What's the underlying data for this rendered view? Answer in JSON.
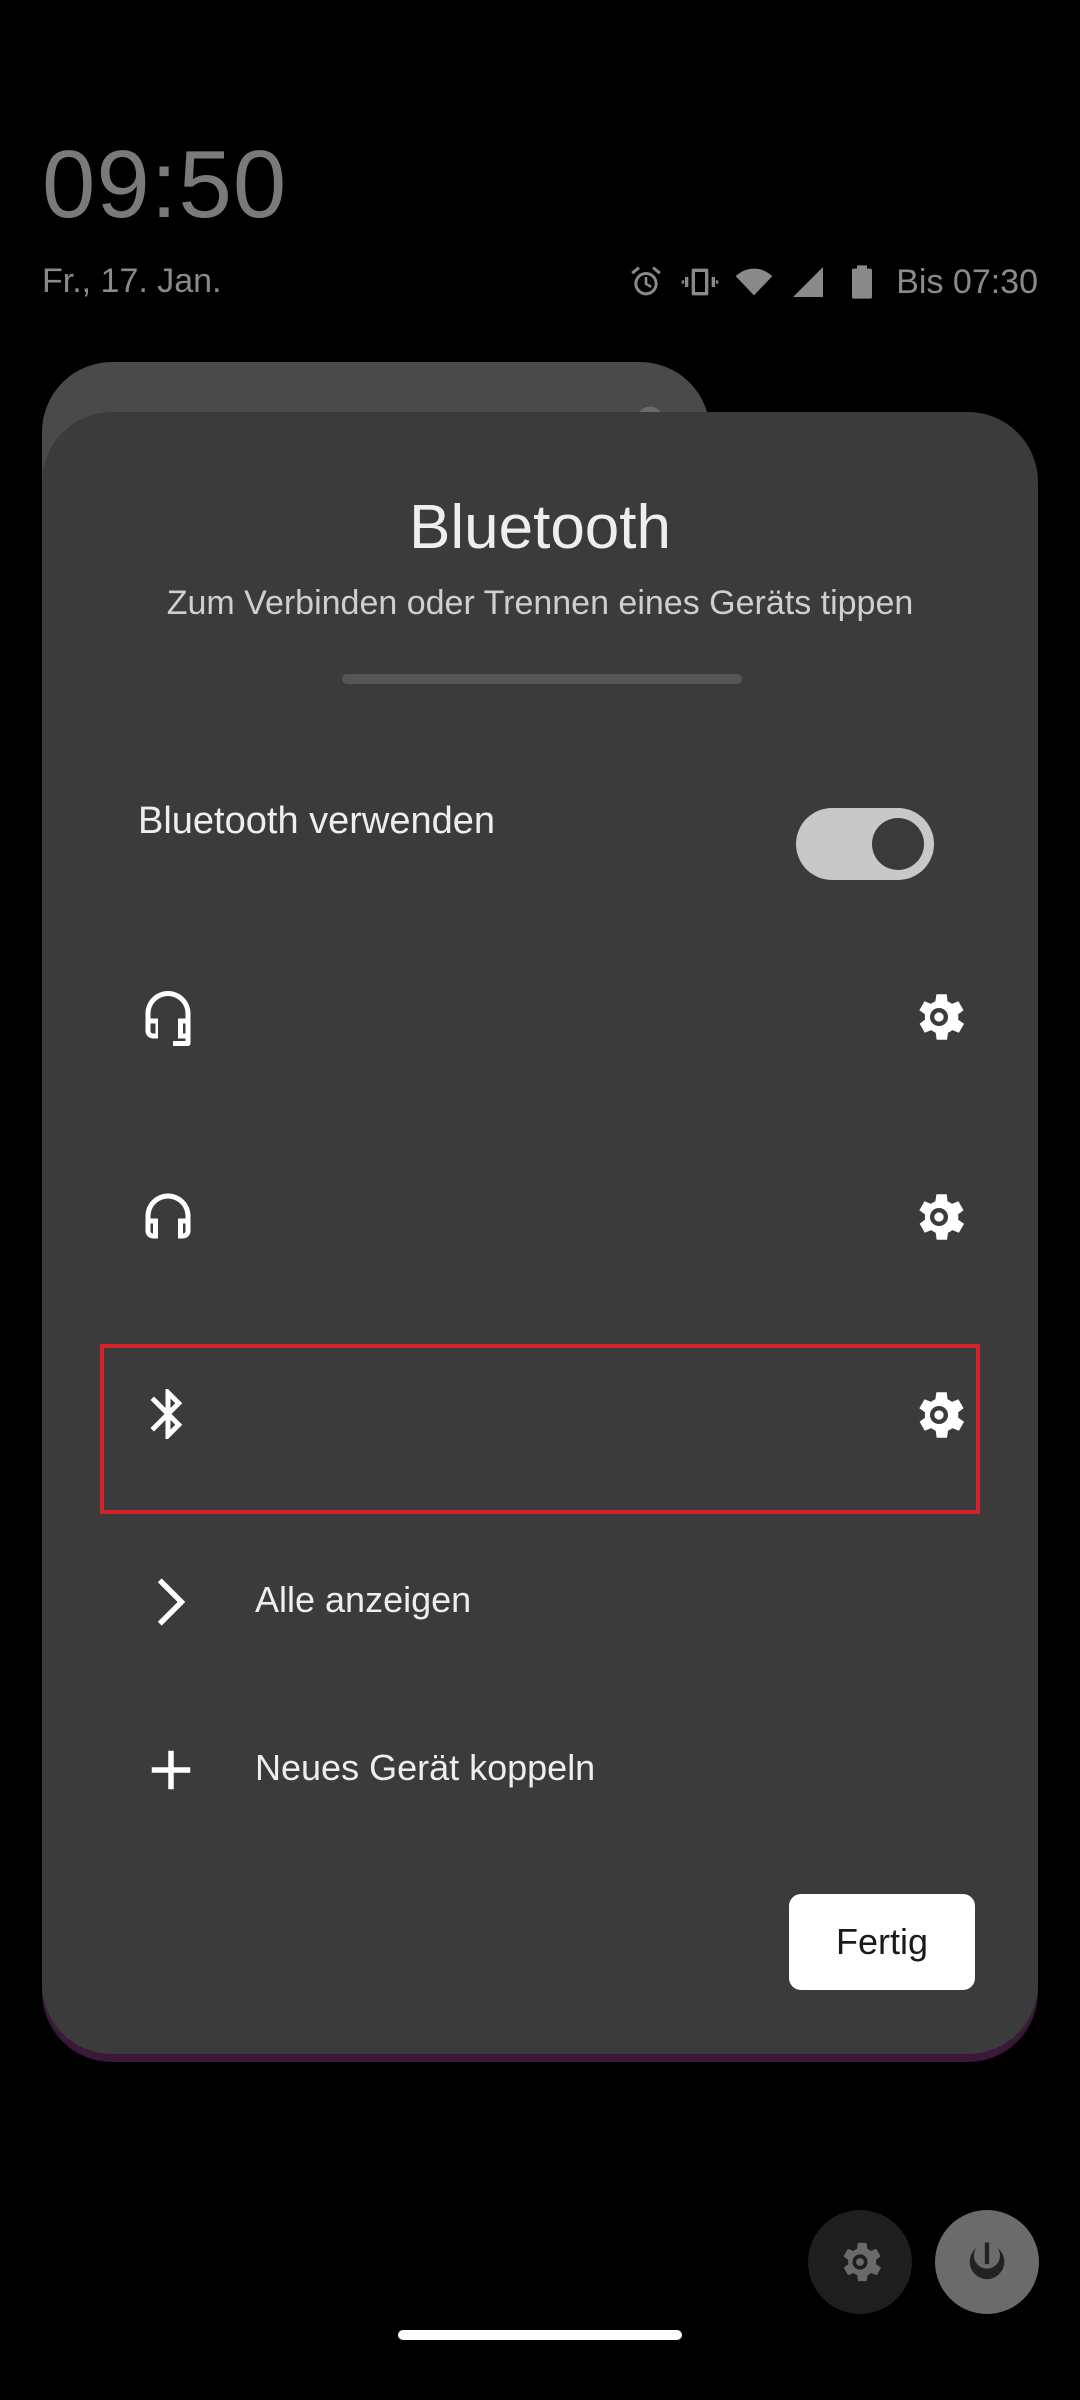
{
  "lockscreen": {
    "time": "09:50",
    "date": "Fr., 17. Jan.",
    "alarm_text": "Bis 07:30"
  },
  "status_icons": [
    "alarm-icon",
    "vibrate-icon",
    "wifi-icon",
    "signal-icon",
    "battery-icon"
  ],
  "dialog": {
    "title": "Bluetooth",
    "subtitle": "Zum Verbinden oder Trennen eines Geräts tippen",
    "toggle_label": "Bluetooth verwenden",
    "toggle_on": true,
    "devices": [
      {
        "icon": "headset-mic-icon"
      },
      {
        "icon": "headphones-icon"
      },
      {
        "icon": "bluetooth-icon",
        "highlighted": true
      }
    ],
    "show_all_label": "Alle anzeigen",
    "pair_new_label": "Neues Gerät koppeln",
    "done_label": "Fertig"
  },
  "colors": {
    "background": "#000000",
    "dialog": "#3b3b3b",
    "highlight": "#d3222a",
    "toggle_track": "#c8c8c8"
  }
}
